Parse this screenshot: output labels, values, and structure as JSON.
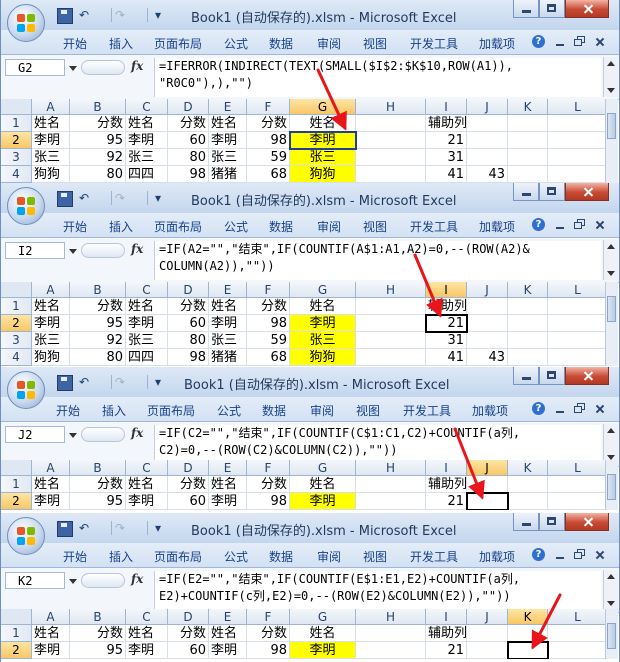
{
  "window": {
    "title": "Book1 (自动保存的).xlsm - Microsoft Excel"
  },
  "ribbon_tabs": [
    "开始",
    "插入",
    "页面布局",
    "公式",
    "数据",
    "审阅",
    "视图",
    "开发工具",
    "加载项"
  ],
  "columns": [
    "A",
    "B",
    "C",
    "D",
    "E",
    "F",
    "G",
    "H",
    "I",
    "J",
    "K",
    "L"
  ],
  "colors": {
    "highlight": "#ffff00",
    "arrow": "#e8161b",
    "selected_header": "#f8c766"
  },
  "panels": [
    {
      "cell_ref": "G2",
      "formula": "=IFERROR(INDIRECT(TEXT(SMALL($I$2:$K$10,ROW(A1)),\n\"R0C0\"),),\"\")",
      "selected_column": "G",
      "rows": [
        {
          "n": "1",
          "cells": {
            "A": "姓名",
            "B": "分数",
            "C": "姓名",
            "D": "分数",
            "E": "姓名",
            "F": "分数",
            "G": "姓名",
            "I": "辅助列"
          }
        },
        {
          "n": "2",
          "cells": {
            "A": "李明",
            "B": "95",
            "C": "李明",
            "D": "60",
            "E": "李明",
            "F": "98",
            "G": "李明",
            "I": "21"
          }
        },
        {
          "n": "3",
          "cells": {
            "A": "张三",
            "B": "92",
            "C": "张三",
            "D": "80",
            "E": "张三",
            "F": "59",
            "G": "张三",
            "I": "31"
          }
        },
        {
          "n": "4",
          "cells": {
            "A": "狗狗",
            "B": "80",
            "C": "四四",
            "D": "98",
            "E": "猪猪",
            "F": "68",
            "G": "狗狗",
            "I": "41",
            "J": "43"
          }
        }
      ]
    },
    {
      "cell_ref": "I2",
      "formula": "=IF(A2=\"\",\"结束\",IF(COUNTIF(A$1:A1,A2)=0,--(ROW(A2)&\nCOLUMN(A2)),\"\"))",
      "selected_column": "I",
      "rows": [
        {
          "n": "1",
          "cells": {
            "A": "姓名",
            "B": "分数",
            "C": "姓名",
            "D": "分数",
            "E": "姓名",
            "F": "分数",
            "G": "姓名",
            "I": "辅助列"
          }
        },
        {
          "n": "2",
          "cells": {
            "A": "李明",
            "B": "95",
            "C": "李明",
            "D": "60",
            "E": "李明",
            "F": "98",
            "G": "李明",
            "I": "21"
          }
        },
        {
          "n": "3",
          "cells": {
            "A": "张三",
            "B": "92",
            "C": "张三",
            "D": "80",
            "E": "张三",
            "F": "59",
            "G": "张三",
            "I": "31"
          }
        },
        {
          "n": "4",
          "cells": {
            "A": "狗狗",
            "B": "80",
            "C": "四四",
            "D": "98",
            "E": "猪猪",
            "F": "68",
            "G": "狗狗",
            "I": "41",
            "J": "43"
          }
        }
      ]
    },
    {
      "cell_ref": "J2",
      "formula": "=IF(C2=\"\",\"结束\",IF(COUNTIF(C$1:C1,C2)+COUNTIF(a列,\nC2)=0,--(ROW(C2)&COLUMN(C2)),\"\"))",
      "selected_column": "J",
      "rows": [
        {
          "n": "1",
          "cells": {
            "A": "姓名",
            "B": "分数",
            "C": "姓名",
            "D": "分数",
            "E": "姓名",
            "F": "分数",
            "G": "姓名",
            "I": "辅助列"
          }
        },
        {
          "n": "2",
          "cells": {
            "A": "李明",
            "B": "95",
            "C": "李明",
            "D": "60",
            "E": "李明",
            "F": "98",
            "G": "李明",
            "I": "21"
          }
        }
      ]
    },
    {
      "cell_ref": "K2",
      "formula": "=IF(E2=\"\",\"结束\",IF(COUNTIF(E$1:E1,E2)+COUNTIF(a列,\nE2)+COUNTIF(c列,E2)=0,--(ROW(E2)&COLUMN(E2)),\"\"))",
      "selected_column": "K",
      "rows": [
        {
          "n": "1",
          "cells": {
            "A": "姓名",
            "B": "分数",
            "C": "姓名",
            "D": "分数",
            "E": "姓名",
            "F": "分数",
            "G": "姓名",
            "I": "辅助列"
          }
        },
        {
          "n": "2",
          "cells": {
            "A": "李明",
            "B": "95",
            "C": "李明",
            "D": "60",
            "E": "李明",
            "F": "98",
            "G": "李明",
            "I": "21"
          }
        }
      ]
    }
  ]
}
